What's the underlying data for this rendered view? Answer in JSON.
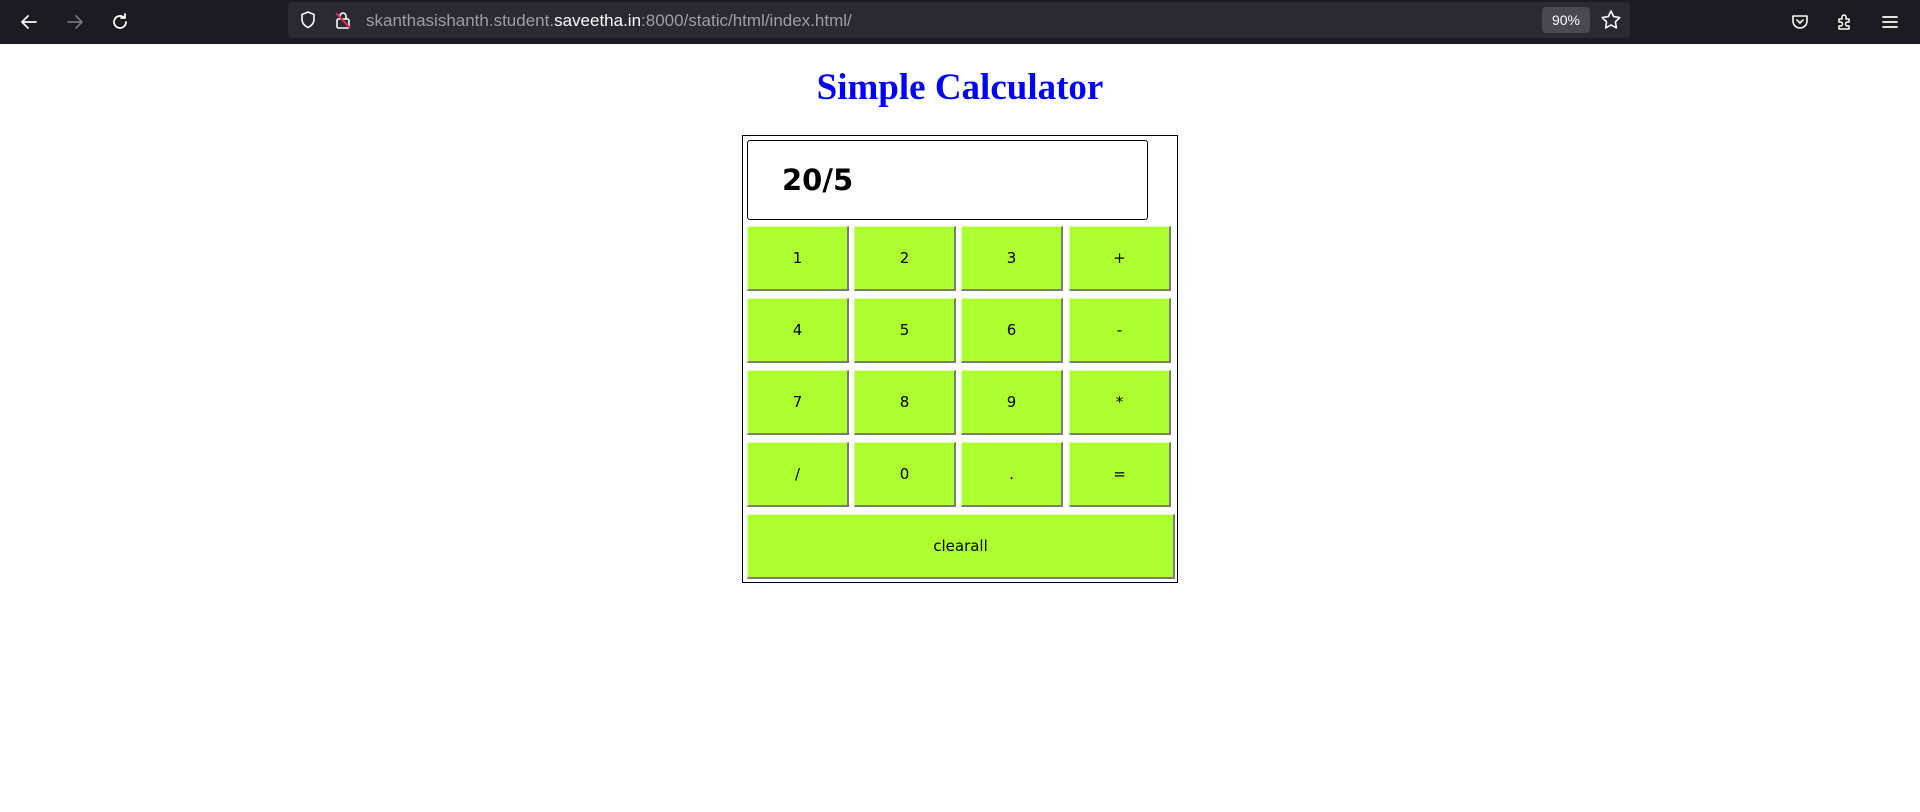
{
  "browser": {
    "url_prefix": "skanthasishanth.student.",
    "url_domain": "saveetha.in",
    "url_suffix": ":8000/static/html/index.html/",
    "zoom": "90%"
  },
  "page": {
    "title": "Simple Calculator"
  },
  "calculator": {
    "display_value": "20/5",
    "keys": [
      [
        "1",
        "2",
        "3",
        "+"
      ],
      [
        "4",
        "5",
        "6",
        "-"
      ],
      [
        "7",
        "8",
        "9",
        "*"
      ],
      [
        "/",
        "0",
        ".",
        "="
      ]
    ],
    "clear_label": "clearall",
    "key_color": "#adff2f"
  },
  "colors": {
    "title": "#0000ff",
    "toolbar_bg": "#1c1b22"
  }
}
